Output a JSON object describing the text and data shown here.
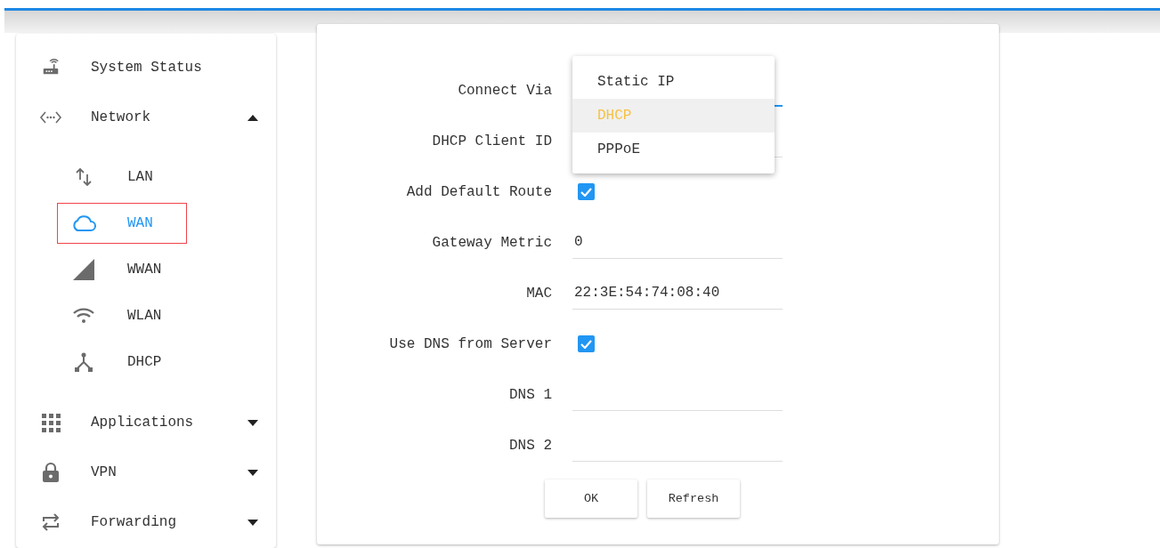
{
  "sidebar": {
    "items": [
      {
        "label": "System Status",
        "selected": false
      },
      {
        "label": "Network",
        "selected": false,
        "expanded": true,
        "children": [
          {
            "label": "LAN",
            "selected": false
          },
          {
            "label": "WAN",
            "selected": true
          },
          {
            "label": "WWAN",
            "selected": false
          },
          {
            "label": "WLAN",
            "selected": false
          },
          {
            "label": "DHCP",
            "selected": false
          }
        ]
      },
      {
        "label": "Applications",
        "selected": false,
        "expanded": false
      },
      {
        "label": "VPN",
        "selected": false,
        "expanded": false
      },
      {
        "label": "Forwarding",
        "selected": false,
        "expanded": false
      }
    ]
  },
  "form": {
    "fields": [
      {
        "kind": "select",
        "label": "Connect Via",
        "open": true,
        "options": [
          {
            "label": "Static IP",
            "selected": false
          },
          {
            "label": "DHCP",
            "selected": true
          },
          {
            "label": "PPPoE",
            "selected": false
          }
        ]
      },
      {
        "kind": "text",
        "label": "DHCP Client ID"
      },
      {
        "kind": "checkbox",
        "label": "Add Default Route",
        "checked": true
      },
      {
        "kind": "text",
        "label": "Gateway Metric",
        "value": "0"
      },
      {
        "kind": "text",
        "label": "MAC",
        "value": "22:3E:54:74:08:40"
      },
      {
        "kind": "checkbox",
        "label": "Use DNS from Server",
        "checked": true
      },
      {
        "kind": "text",
        "label": "DNS 1"
      },
      {
        "kind": "text",
        "label": "DNS 2"
      }
    ],
    "buttons": [
      {
        "label": "OK"
      },
      {
        "label": "Refresh"
      }
    ]
  }
}
